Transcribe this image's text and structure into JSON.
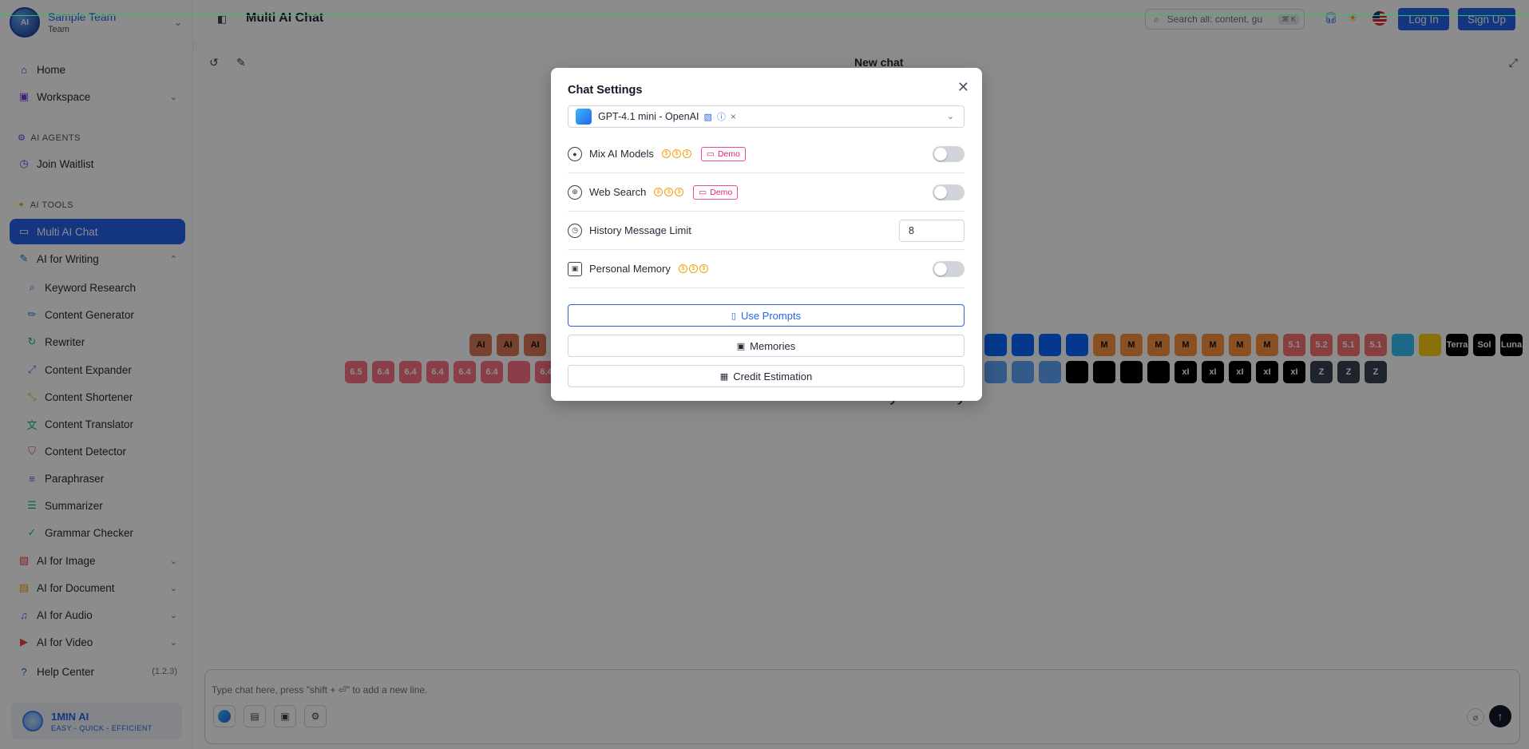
{
  "team": {
    "name": "Sample Team",
    "sub": "Team"
  },
  "sidebar": {
    "home": "Home",
    "workspace": "Workspace",
    "section_agents": "AI AGENTS",
    "join_waitlist": "Join Waitlist",
    "section_tools": "AI TOOLS",
    "multi_ai_chat": "Multi AI Chat",
    "ai_for_writing": "AI for Writing",
    "writing_items": [
      "Keyword Research",
      "Content Generator",
      "Rewriter",
      "Content Expander",
      "Content Shortener",
      "Content Translator",
      "Content Detector",
      "Paraphraser",
      "Summarizer",
      "Grammar Checker"
    ],
    "ai_for_image": "AI for Image",
    "ai_for_document": "AI for Document",
    "ai_for_audio": "AI for Audio",
    "ai_for_video": "AI for Video",
    "help_center": "Help Center",
    "version": "(1.2.3)"
  },
  "brand": {
    "name": "1MIN AI",
    "tagline": "EASY - QUICK - EFFICIENT"
  },
  "header": {
    "title": "Multi AI Chat",
    "search_placeholder": "Search all: content, gui",
    "search_kbd": "⌘ K",
    "login": "Log In",
    "signup": "Sign Up"
  },
  "chat": {
    "title": "New chat",
    "greeting": "How can I assist you today?",
    "input_placeholder": "Type chat here, press \"shift + ⏎\" to add a new line.",
    "row1_labels": [
      "",
      "",
      "",
      "",
      "",
      "",
      "",
      "",
      "",
      "",
      "AI",
      "AI",
      "AI"
    ],
    "row1_right_labels": [
      "",
      "",
      "",
      "",
      "M",
      "M",
      "M",
      "M",
      "M",
      "M",
      "M",
      "5.1",
      "5.2",
      "5.1",
      "5.1",
      "",
      "",
      "Terra",
      "Sol",
      "Luna"
    ],
    "row2_labels": [
      "6.5",
      "6.4",
      "6.4",
      "6.4",
      "6.4",
      "6.4",
      "",
      "6.4"
    ],
    "row2_right_labels": [
      "",
      "",
      "",
      "",
      "",
      "",
      "",
      "xI",
      "xI",
      "xI",
      "xI",
      "xI",
      "Z",
      "Z",
      "Z"
    ]
  },
  "modal": {
    "title": "Chat Settings",
    "model_chip": "GPT-4.1 mini - OpenAI",
    "settings": {
      "mix_ai_models": "Mix AI Models",
      "web_search": "Web Search",
      "history_limit": "History Message Limit",
      "history_value": "8",
      "personal_memory": "Personal Memory",
      "demo": "Demo"
    },
    "buttons": {
      "use_prompts": "Use Prompts",
      "memories": "Memories",
      "credit_estimation": "Credit Estimation"
    }
  },
  "colors": {
    "accent": "#2563eb",
    "demo": "#db2777",
    "coin": "#f59e0b"
  }
}
